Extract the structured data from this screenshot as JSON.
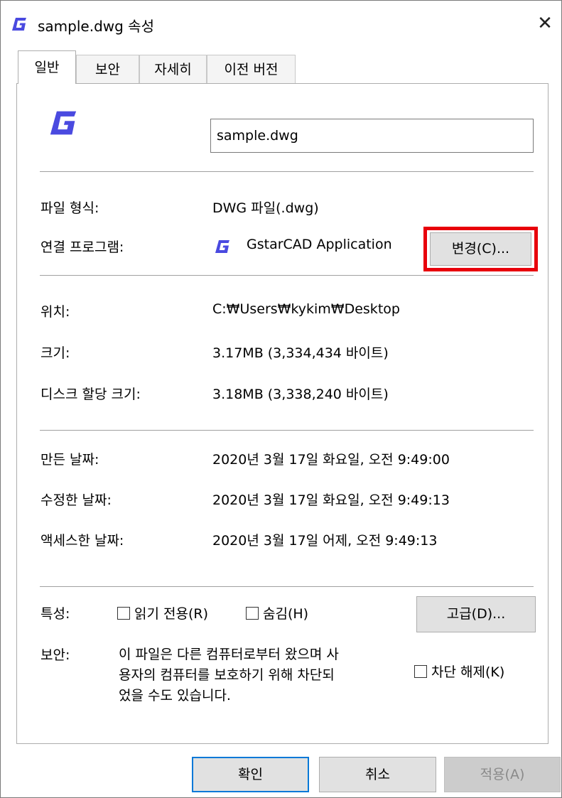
{
  "window": {
    "title": "sample.dwg 속성",
    "close_glyph": "✕",
    "accent": "#4a4ae0"
  },
  "tabs": [
    {
      "label": "일반",
      "active": true
    },
    {
      "label": "보안",
      "active": false
    },
    {
      "label": "자세히",
      "active": false
    },
    {
      "label": "이전 버전",
      "active": false
    }
  ],
  "file": {
    "name": "sample.dwg",
    "icon": "gstarcad-icon"
  },
  "type_section": {
    "file_type_label": "파일 형식:",
    "file_type_value": "DWG 파일(.dwg)",
    "opens_with_label": "연결 프로그램:",
    "opens_with_value": "GstarCAD Application",
    "change_button": "변경(C)..."
  },
  "location_section": {
    "location_label": "위치:",
    "location_value": "C:₩Users₩kykim₩Desktop",
    "size_label": "크기:",
    "size_value": "3.17MB (3,334,434 바이트)",
    "size_on_disk_label": "디스크 할당 크기:",
    "size_on_disk_value": "3.18MB (3,338,240 바이트)"
  },
  "dates_section": {
    "created_label": "만든 날짜:",
    "created_value": "2020년 3월 17일 화요일, 오전 9:49:00",
    "modified_label": "수정한 날짜:",
    "modified_value": "2020년 3월 17일 화요일, 오전 9:49:13",
    "accessed_label": "액세스한 날짜:",
    "accessed_value": "2020년 3월 17일 어제, 오전 9:49:13"
  },
  "attributes": {
    "label": "특성:",
    "readonly_label": "읽기 전용(R)",
    "readonly_checked": false,
    "hidden_label": "숨김(H)",
    "hidden_checked": false,
    "advanced_button": "고급(D)..."
  },
  "security": {
    "label": "보안:",
    "message_line1": "이 파일은 다른 컴퓨터로부터 왔으며 사",
    "message_line2": "용자의 컴퓨터를 보호하기 위해 차단되",
    "message_line3": "었을 수도 있습니다.",
    "unblock_label": "차단 해제(K)",
    "unblock_checked": false
  },
  "footer": {
    "ok": "확인",
    "cancel": "취소",
    "apply": "적용(A)"
  },
  "colors": {
    "highlight_border": "#e8000b",
    "default_button_border": "#0078d7",
    "disabled_text": "#8a8a8a"
  }
}
